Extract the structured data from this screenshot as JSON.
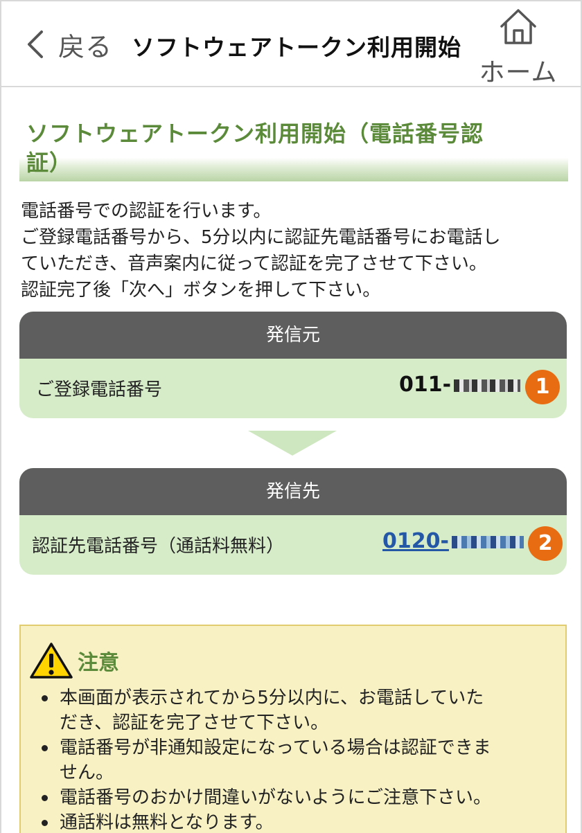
{
  "header": {
    "back_label": "戻る",
    "title": "ソフトウェアトークン利用開始",
    "home_label": "ホーム"
  },
  "section": {
    "title_line1": "ソフトウェアトークン利用開始（電話番号認",
    "title_line2": "証）"
  },
  "description": [
    "電話番号での認証を行います。",
    "ご登録電話番号から、5分以内に認証先電話番号にお電話し",
    "ていただき、音声案内に従って認証を完了させて下さい。",
    "認証完了後「次へ」ボタンを押して下さい。"
  ],
  "caller": {
    "heading": "発信元",
    "label": "ご登録電話番号",
    "number_prefix": "011-",
    "badge": "1"
  },
  "callee": {
    "heading": "発信先",
    "label": "認証先電話番号（通話料無料）",
    "number_prefix": "0120-",
    "badge": "2"
  },
  "notice": {
    "title": "注意",
    "items": [
      [
        "本画面が表示されてから5分以内に、お電話していた",
        "だき、認証を完了させて下さい。"
      ],
      [
        "電話番号が非通知設定になっている場合は認証できま",
        "せん。"
      ],
      [
        "電話番号のおかけ間違いがないようにご注意下さい。"
      ],
      [
        "通話料は無料となります。"
      ]
    ]
  },
  "colors": {
    "accent_green": "#5b8a3a",
    "card_green": "#d6ecc9",
    "card_header": "#5e5e5e",
    "badge_orange": "#e86d12",
    "link_blue": "#2458a6",
    "notice_bg": "#f7f1c4"
  }
}
